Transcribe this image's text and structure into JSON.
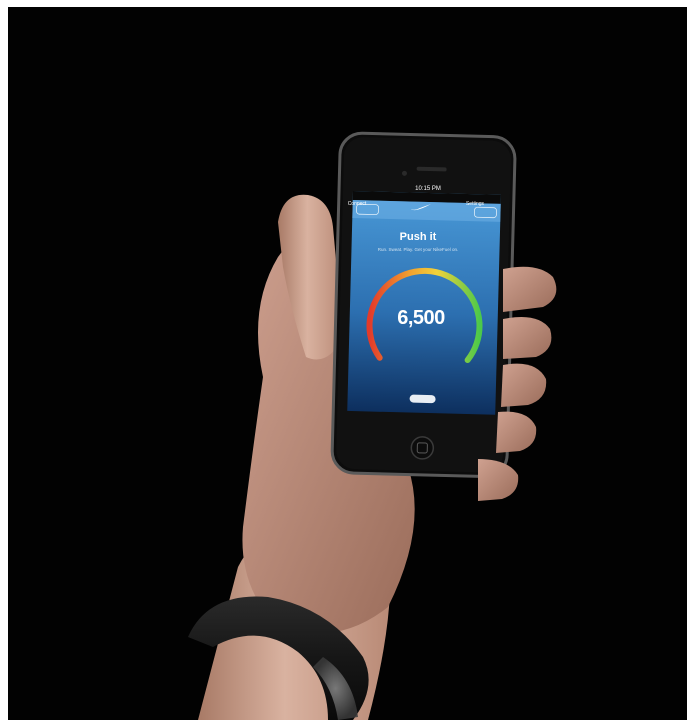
{
  "phone": {
    "status_bar": {
      "time": "10:15 PM"
    },
    "nav": {
      "left_button": "Connect",
      "right_button": "Settings"
    },
    "title": "Push it",
    "subtitle": "Run. Sweat. Play. Get your NikeFuel on.",
    "fuel_value": "6,500"
  },
  "colors": {
    "screen_top": "#3d8fd0",
    "screen_bottom": "#0f3a70",
    "gauge_red": "#e23a2a",
    "gauge_yellow": "#f2d23a",
    "gauge_green": "#4cc94a",
    "background": "#020202",
    "band": "#1e1e1e"
  },
  "icons": [
    "nike-swoosh-icon",
    "home-button-icon"
  ]
}
